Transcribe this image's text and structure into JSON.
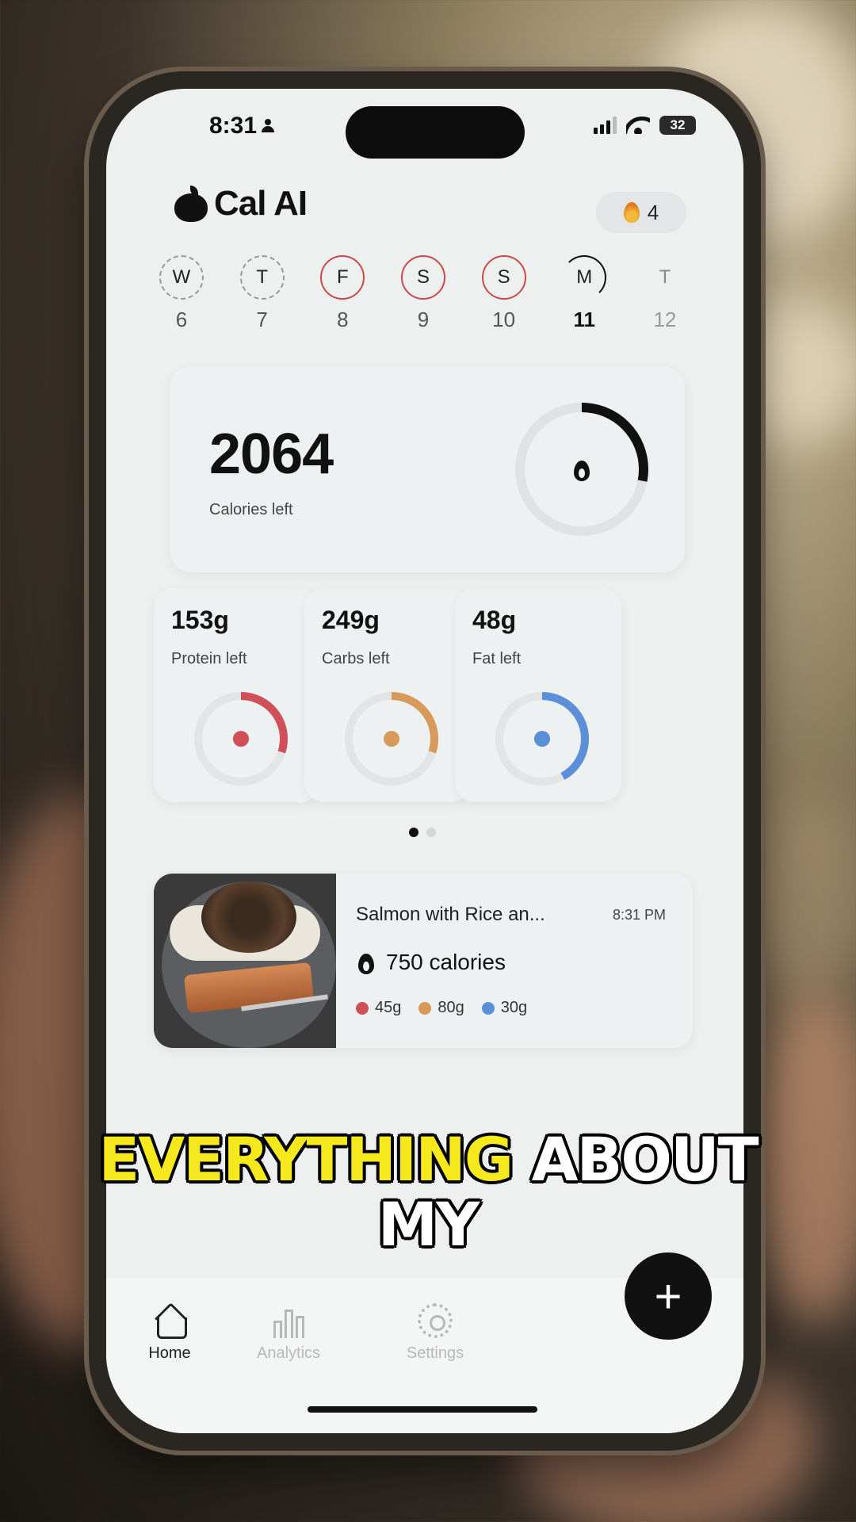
{
  "status_bar": {
    "time": "8:31",
    "battery": "32"
  },
  "app": {
    "title": "Cal AI",
    "streak_count": "4"
  },
  "week": [
    {
      "letter": "W",
      "num": "6",
      "state": "dashed"
    },
    {
      "letter": "T",
      "num": "7",
      "state": "dashed"
    },
    {
      "letter": "F",
      "num": "8",
      "state": "logged"
    },
    {
      "letter": "S",
      "num": "9",
      "state": "logged"
    },
    {
      "letter": "S",
      "num": "10",
      "state": "logged"
    },
    {
      "letter": "M",
      "num": "11",
      "state": "today"
    },
    {
      "letter": "T",
      "num": "12",
      "state": "future"
    }
  ],
  "calories": {
    "value": "2064",
    "label": "Calories left",
    "progress": 0.28
  },
  "macros": [
    {
      "value": "153g",
      "label": "Protein left",
      "progress": 0.3,
      "color": "#d0505a",
      "icon": "drumstick-icon"
    },
    {
      "value": "249g",
      "label": "Carbs left",
      "progress": 0.3,
      "color": "#d89a5a",
      "icon": "wheat-icon"
    },
    {
      "value": "48g",
      "label": "Fat left",
      "progress": 0.42,
      "color": "#5b8fd8",
      "icon": "oil-drop-icon"
    }
  ],
  "pager": {
    "active": 0,
    "count": 2
  },
  "meal": {
    "name": "Salmon with Rice an...",
    "time": "8:31 PM",
    "calories": "750 calories",
    "protein": "45g",
    "carbs": "80g",
    "fat": "30g"
  },
  "nav": {
    "home": "Home",
    "analytics": "Analytics",
    "settings": "Settings",
    "add": "+"
  },
  "caption": {
    "highlight": "EVERYTHING",
    "line1_rest": "ABOUT",
    "line2": "MY"
  },
  "colors": {
    "accent": "#111111",
    "protein": "#d0505a",
    "carbs": "#d89a5a",
    "fat": "#5b8fd8",
    "caption_highlight": "#f5e81c"
  }
}
